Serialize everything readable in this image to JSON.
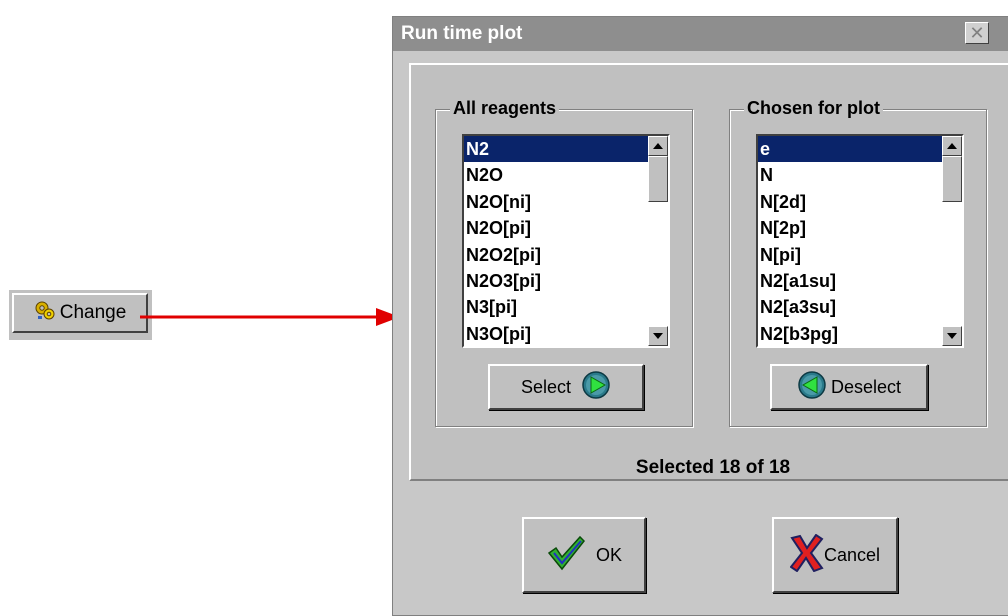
{
  "external": {
    "change_label": "Change"
  },
  "dialog": {
    "title": "Run time plot",
    "close_symbol": "✕",
    "all_reagents": {
      "title": "All reagents",
      "items": [
        "N2",
        "N2O",
        "N2O[ni]",
        "N2O[pi]",
        "N2O2[pi]",
        "N2O3[pi]",
        "N3[pi]",
        "N3O[pi]"
      ],
      "selected_index": 0
    },
    "chosen": {
      "title": "Chosen for plot",
      "items": [
        "e",
        "N",
        "N[2d]",
        "N[2p]",
        "N[pi]",
        "N2[a1su]",
        "N2[a3su]",
        "N2[b3pg]"
      ],
      "selected_index": 0
    },
    "select_label": "Select",
    "deselect_label": "Deselect",
    "status": "Selected 18  of  18",
    "ok_label": "OK",
    "cancel_label": "Cancel"
  },
  "colors": {
    "selection": "#0a246a",
    "arrow": "#e00000",
    "titlebar": "#8e8e8e"
  },
  "icons": [
    "gears-icon",
    "green-play-icon",
    "green-back-icon",
    "check-icon",
    "x-icon"
  ]
}
